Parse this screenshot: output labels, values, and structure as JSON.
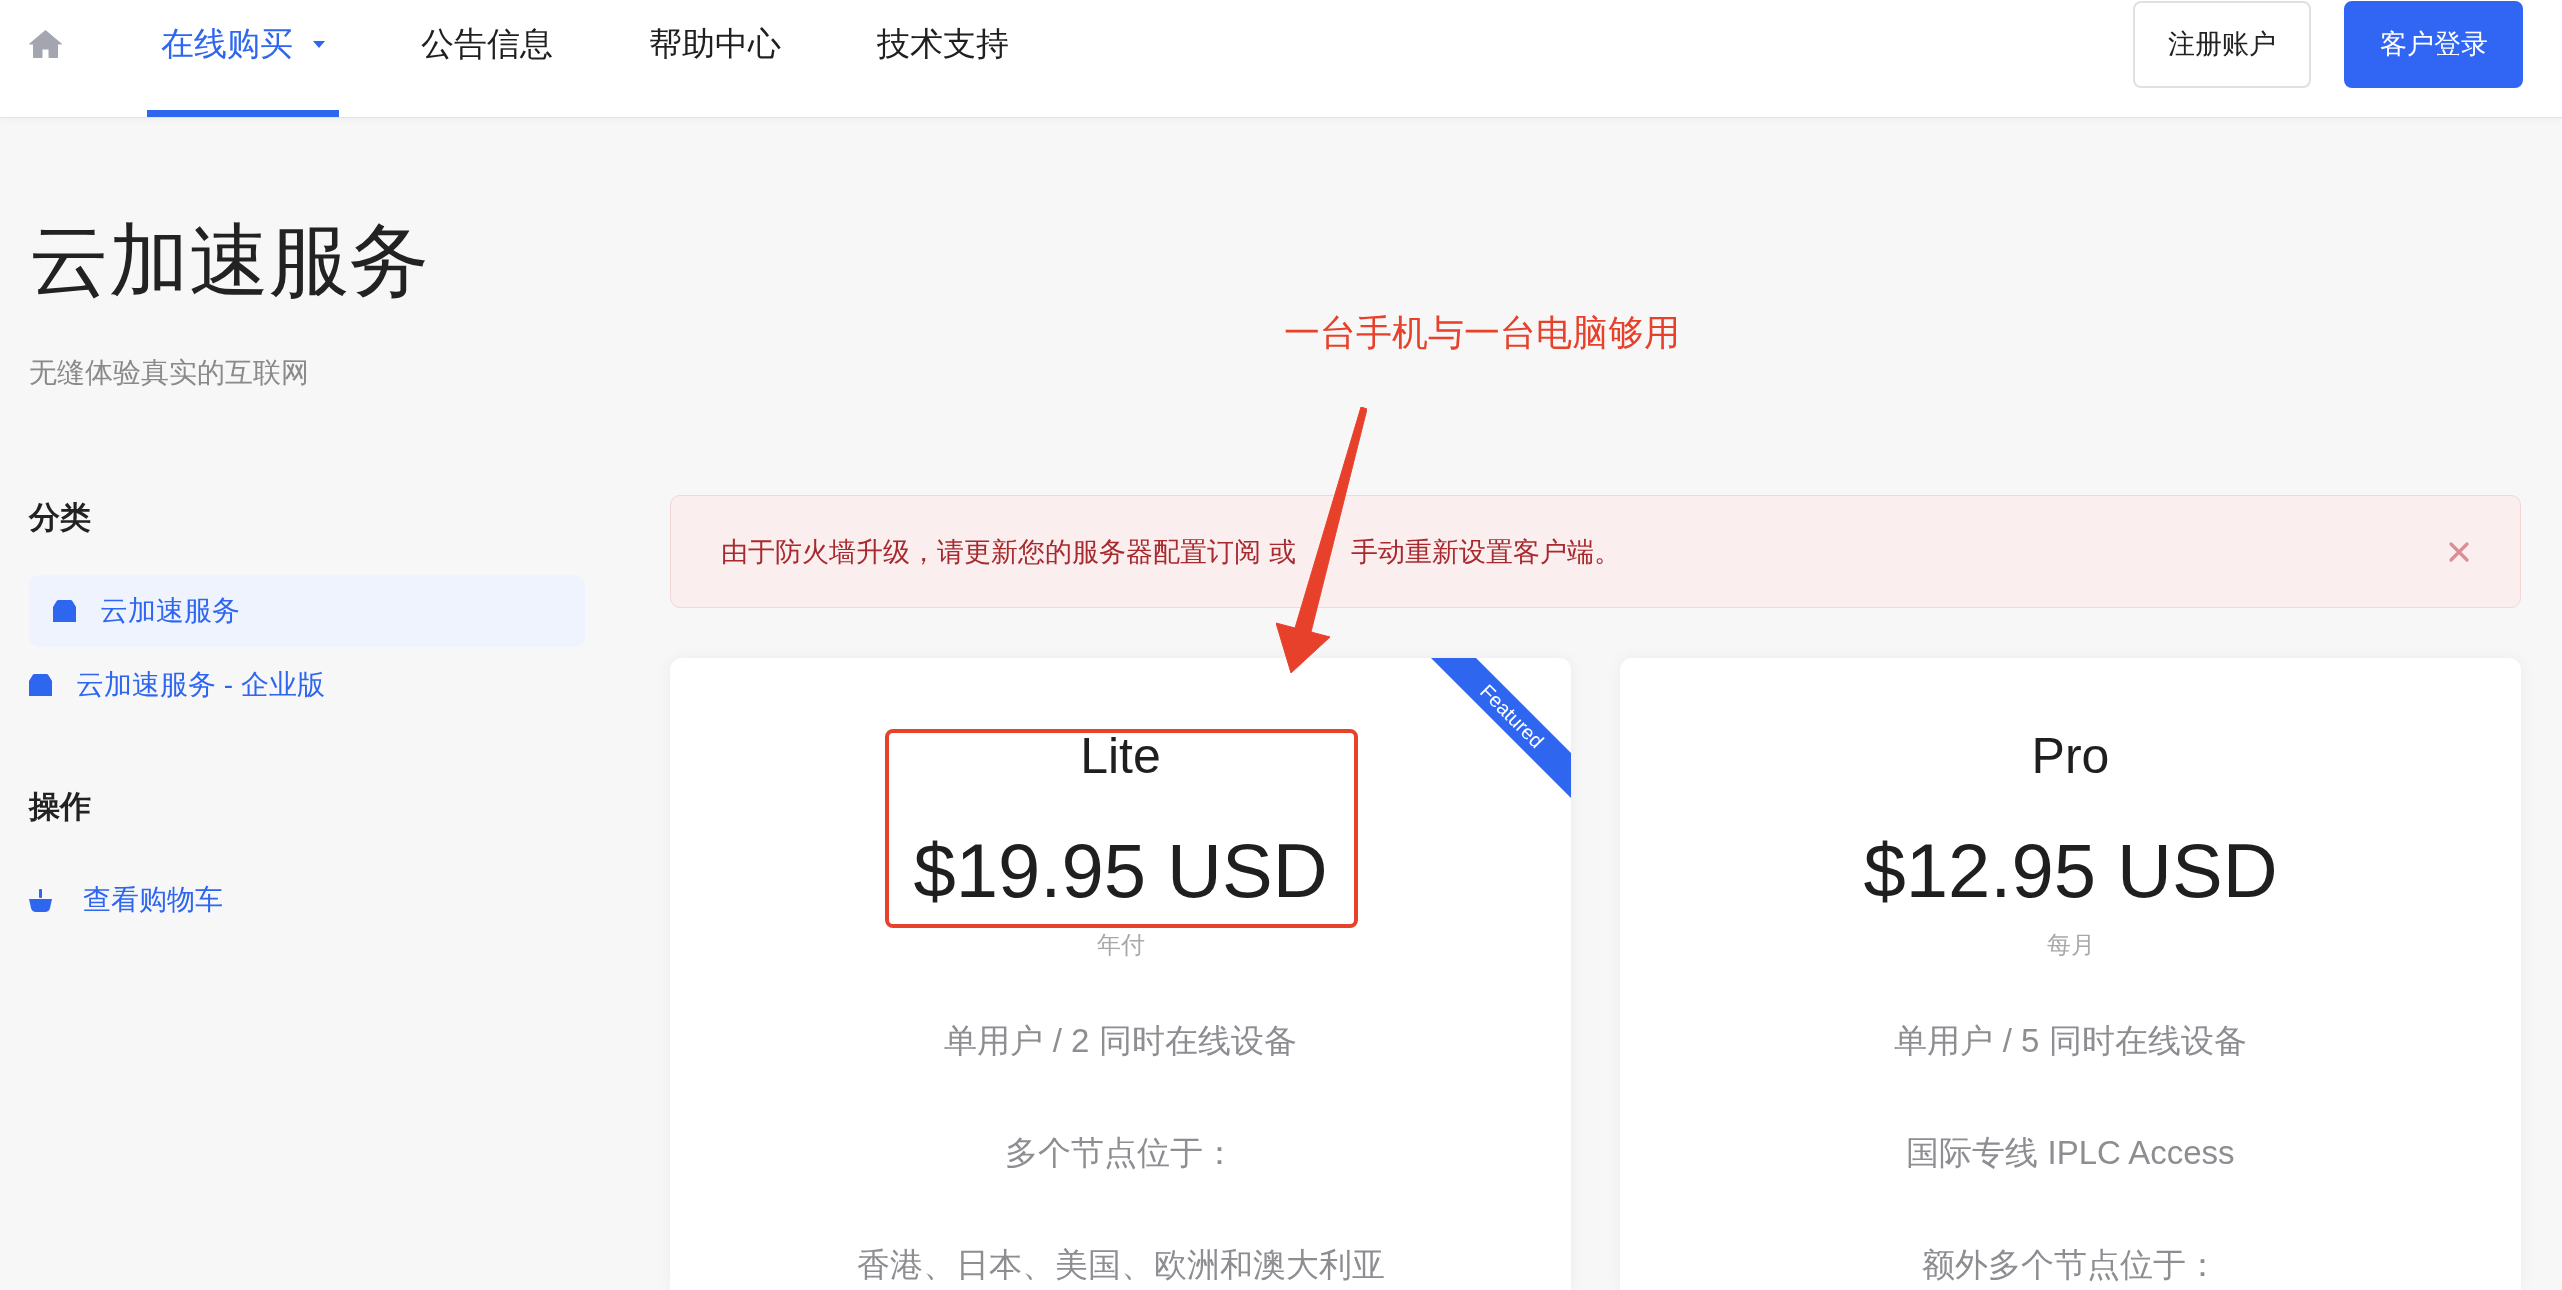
{
  "nav": {
    "items": [
      {
        "label": "在线购买",
        "selected": true,
        "dropdown": true
      },
      {
        "label": "公告信息",
        "selected": false,
        "dropdown": false
      },
      {
        "label": "帮助中心",
        "selected": false,
        "dropdown": false
      },
      {
        "label": "技术支持",
        "selected": false,
        "dropdown": false
      }
    ],
    "buttons": [
      {
        "label": "注册账户",
        "kind": "outline"
      },
      {
        "label": "客户登录",
        "kind": "primary"
      }
    ]
  },
  "header": {
    "title": "云加速服务",
    "subtitle": "无缝体验真实的互联网"
  },
  "sidebar": {
    "sections": [
      {
        "heading": "分类",
        "kind": "categories",
        "items": [
          {
            "label": "云加速服务",
            "selected": true
          },
          {
            "label": "云加速服务 - 企业版",
            "selected": false
          }
        ]
      },
      {
        "heading": "操作",
        "kind": "actions",
        "items": [
          {
            "label": "查看购物车"
          }
        ]
      }
    ]
  },
  "alert": {
    "parts": [
      "由于防火墙升级，请更新您的服务器配置订阅 或",
      "手动重新设置客户端。"
    ],
    "dismissible": true
  },
  "annotation": {
    "text": "一台手机与一台电脑够用"
  },
  "plans": [
    {
      "name": "Lite",
      "price": "$19.95 USD",
      "period": "年付",
      "ribbon": "Featured",
      "features": [
        "单用户 / 2 同时在线设备",
        "多个节点位于：",
        "香港、日本、美国、欧洲和澳大利亚"
      ]
    },
    {
      "name": "Pro",
      "price": "$12.95 USD",
      "period": "每月",
      "features": [
        "单用户 / 5 同时在线设备",
        "国际专线 IPLC Access",
        "额外多个节点位于："
      ]
    }
  ]
}
